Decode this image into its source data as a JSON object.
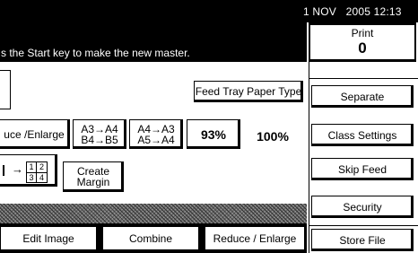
{
  "status": {
    "datetime": "1 NOV   2005 12:13"
  },
  "message": "s the Start key to make the new master.",
  "print": {
    "label": "Print",
    "count": "0"
  },
  "right_buttons": [
    "Separate",
    "Class Settings",
    "Skip Feed",
    "Security",
    "Store File"
  ],
  "feed_tray_button": "Feed Tray Paper Type",
  "reduce_row": {
    "reduce_enlarge": "uce /Enlarge",
    "a3_a4_line1": "A3→A4",
    "a3_a4_line2": "B4→B5",
    "a4_a3_line1": "A4→A3",
    "a4_a3_line2": "A5→A4",
    "pct_93": "93%",
    "pct_100": "100%"
  },
  "combine_row": {
    "arrow": "→",
    "grid": [
      "1",
      "2",
      "3",
      "4"
    ],
    "create_margin_line1": "Create",
    "create_margin_line2": "Margin"
  },
  "tabs": [
    "Edit Image",
    "Combine",
    "Reduce / Enlarge"
  ]
}
